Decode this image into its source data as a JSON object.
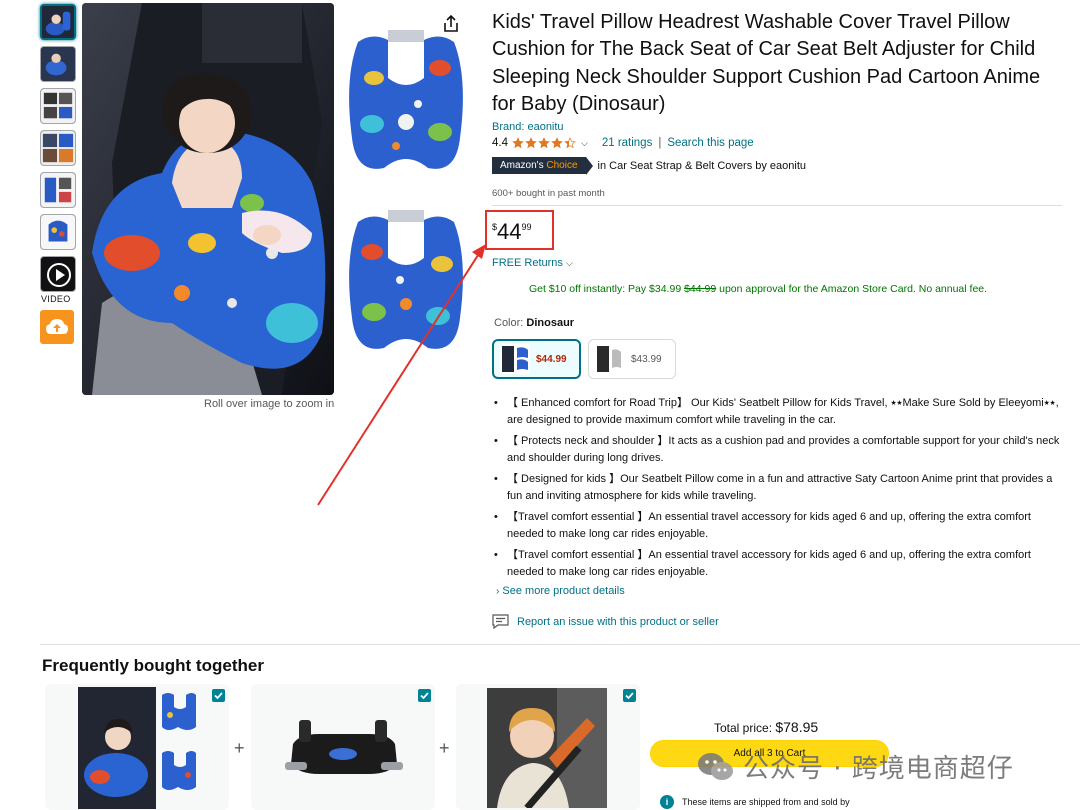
{
  "product": {
    "title": "Kids' Travel Pillow Headrest Washable Cover Travel Pillow Cushion for The Back Seat of Car Seat Belt Adjuster for Child Sleeping Neck Shoulder Support Cushion Pad Cartoon Anime for Baby (Dinosaur)",
    "brand": "Brand: eaonitu",
    "rating": "4.4",
    "stars_value": 4.4,
    "ratings_count": "21 ratings",
    "separator": "|",
    "search_page": "Search this page",
    "badge_prefix": "Amazon's",
    "badge_choice": "Choice",
    "badge_category": "in Car Seat Strap & Belt Covers by eaonitu",
    "bought": "600+ bought in past month",
    "price": {
      "currency": "$",
      "whole": "44",
      "fraction": "99"
    },
    "free_returns": "FREE Returns",
    "card_offer": {
      "prefix": "Get $10 off instantly: Pay $34.99 ",
      "strike": "$44.99",
      "suffix": " upon approval for the Amazon Store Card. No annual fee."
    },
    "color_label": "Color: ",
    "color_value": "Dinosaur",
    "swatches": [
      {
        "price": "$44.99",
        "selected": true
      },
      {
        "price": "$43.99",
        "selected": false
      }
    ],
    "bullets": [
      "【 Enhanced comfort for Road Trip】 Our Kids' Seatbelt Pillow for Kids Travel, ⭑⭑Make Sure Sold by Eleeyomi⭑⭑, are designed to provide maximum comfort while traveling in the car.",
      "【 Protects neck and shoulder 】It acts as a cushion pad and provides a comfortable support for your child's neck and shoulder during long drives.",
      "【 Designed for kids 】Our Seatbelt Pillow come in a fun and attractive Saty Cartoon Anime print that provides a fun and inviting atmosphere for kids while traveling.",
      "【Travel comfort essential 】An essential travel accessory for kids aged 6 and up, offering the extra comfort needed to make long car rides enjoyable.",
      "【Travel comfort essential 】An essential travel accessory for kids aged 6 and up, offering the extra comfort needed to make long car rides enjoyable."
    ],
    "see_more": "See more product details",
    "report": "Report an issue with this product or seller"
  },
  "gallery": {
    "video_label": "VIDEO",
    "zoom_hint": "Roll over image to zoom in"
  },
  "fbt": {
    "title": "Frequently bought together",
    "plus": "+",
    "total_label": "Total price: ",
    "total_amount": "$78.95",
    "add_button": "Add all 3 to Cart",
    "shipped_note": "These items are shipped from and sold by"
  },
  "watermark": {
    "text": "公众号 · 跨境电商超仔"
  },
  "colors": {
    "link": "#007185",
    "price_red": "#b12704",
    "green": "#007600",
    "highlight_box": "#e0312b",
    "button_yellow": "#ffd814",
    "badge_dark": "#232f3e",
    "star": "#de7921"
  }
}
